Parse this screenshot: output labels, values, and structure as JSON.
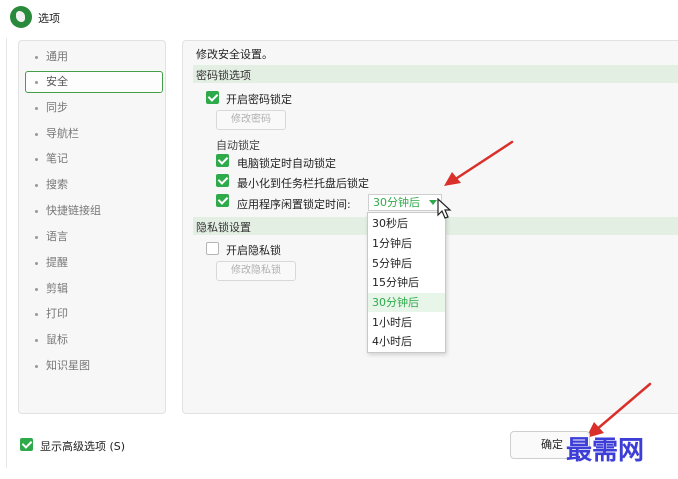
{
  "window": {
    "title": "选项"
  },
  "sidebar": {
    "items": [
      {
        "label": "通用"
      },
      {
        "label": "安全"
      },
      {
        "label": "同步"
      },
      {
        "label": "导航栏"
      },
      {
        "label": "笔记"
      },
      {
        "label": "搜索"
      },
      {
        "label": "快捷链接组"
      },
      {
        "label": "语言"
      },
      {
        "label": "提醒"
      },
      {
        "label": "剪辑"
      },
      {
        "label": "打印"
      },
      {
        "label": "鼠标"
      },
      {
        "label": "知识星图"
      }
    ],
    "active_index": 1
  },
  "security": {
    "heading": "修改安全设置。",
    "password_section": "密码锁选项",
    "enable_password_lock": {
      "label": "开启密码锁定",
      "checked": true
    },
    "change_password_button": "修改密码",
    "auto_lock_label": "自动锁定",
    "lock_on_sleep": {
      "label": "电脑锁定时自动锁定",
      "checked": true
    },
    "lock_on_minimize": {
      "label": "最小化到任务栏托盘后锁定",
      "checked": true
    },
    "idle_lock": {
      "label": "应用程序闲置锁定时间:",
      "checked": true,
      "value": "30分钟后"
    },
    "idle_options": [
      "30秒后",
      "1分钟后",
      "5分钟后",
      "15分钟后",
      "30分钟后",
      "1小时后",
      "4小时后"
    ],
    "idle_selected_index": 4,
    "privacy_section": "隐私锁设置",
    "enable_privacy_lock": {
      "label": "开启隐私锁",
      "checked": false
    },
    "change_privacy_button": "修改隐私锁"
  },
  "footer": {
    "show_advanced": {
      "label": "显示高级选项 (S)",
      "checked": true
    },
    "ok_button": "确定"
  },
  "watermark": "最需网",
  "colors": {
    "accent": "#2eaa4a",
    "annotation_arrow": "#d9302c",
    "watermark": "#3d3dd8"
  }
}
